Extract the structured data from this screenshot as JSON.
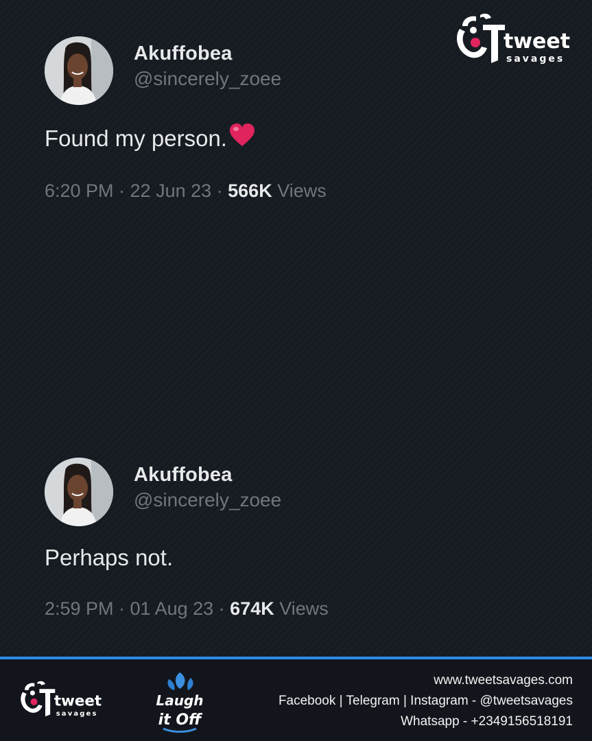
{
  "brand": {
    "name": "tweet",
    "sub": "savages"
  },
  "tweets": [
    {
      "display_name": "Akuffobea",
      "handle": "@sincerely_zoee",
      "text": "Found my person.",
      "emoji": "heart-icon",
      "time": "6:20 PM · 22 Jun 23 · ",
      "views_count": "566K",
      "views_label": " Views"
    },
    {
      "display_name": "Akuffobea",
      "handle": "@sincerely_zoee",
      "text": "Perhaps not.",
      "time": "2:59 PM · 01 Aug 23 · ",
      "views_count": "674K",
      "views_label": " Views"
    }
  ],
  "footer": {
    "laugh_logo_line1": "Laugh",
    "laugh_logo_line2": "it Off",
    "website": "www.tweetsavages.com",
    "socials": "Facebook | Telegram | Instagram - @tweetsavages",
    "whatsapp": "Whatsapp - +2349156518191"
  },
  "colors": {
    "background": "#161b22",
    "text_primary": "#e7e9ea",
    "text_secondary": "#71767b",
    "accent_line": "#2f8bea",
    "heart": "#e0245e"
  }
}
